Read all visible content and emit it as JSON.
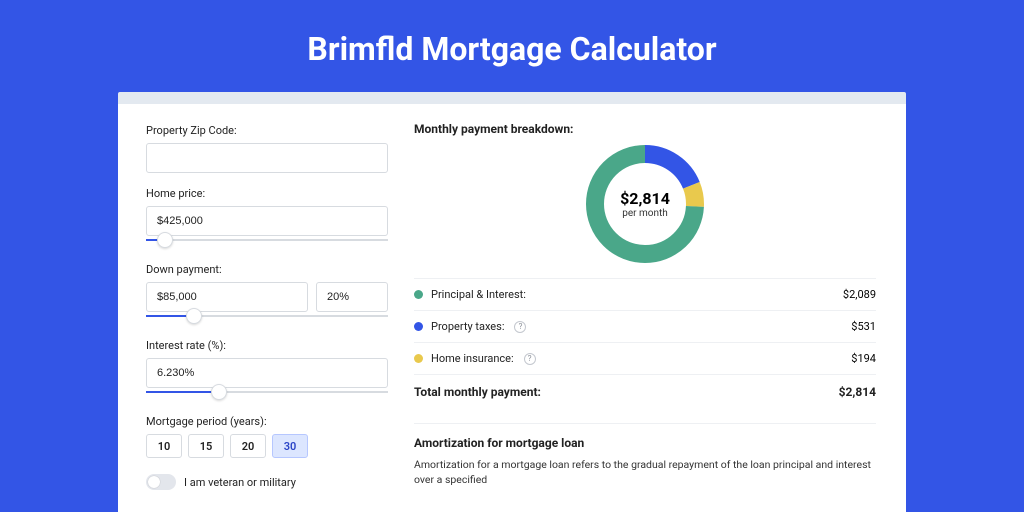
{
  "title": "Brimfld Mortgage Calculator",
  "form": {
    "zip_label": "Property Zip Code:",
    "zip_value": "",
    "home_price_label": "Home price:",
    "home_price_value": "$425,000",
    "home_price_slider_pct": 8,
    "down_payment_label": "Down payment:",
    "down_payment_value": "$85,000",
    "down_payment_pct_value": "20%",
    "down_payment_slider_pct": 20,
    "interest_label": "Interest rate (%):",
    "interest_value": "6.230%",
    "interest_slider_pct": 30,
    "period_label": "Mortgage period (years):",
    "period_options": [
      "10",
      "15",
      "20",
      "30"
    ],
    "period_selected": "30",
    "veteran_label": "I am veteran or military"
  },
  "breakdown": {
    "heading": "Monthly payment breakdown:",
    "center_amount": "$2,814",
    "center_sub": "per month",
    "items": [
      {
        "label": "Principal & Interest:",
        "value": "$2,089",
        "color": "#4aa789",
        "has_help": false
      },
      {
        "label": "Property taxes:",
        "value": "$531",
        "color": "#3355e6",
        "has_help": true
      },
      {
        "label": "Home insurance:",
        "value": "$194",
        "color": "#e9c94d",
        "has_help": true
      }
    ],
    "total_label": "Total monthly payment:",
    "total_value": "$2,814"
  },
  "chart_data": {
    "type": "pie",
    "title": "Monthly payment breakdown",
    "series": [
      {
        "name": "Principal & Interest",
        "value": 2089,
        "color": "#4aa789"
      },
      {
        "name": "Property taxes",
        "value": 531,
        "color": "#3355e6"
      },
      {
        "name": "Home insurance",
        "value": 194,
        "color": "#e9c94d"
      }
    ],
    "total": 2814,
    "center_label": "$2,814 per month"
  },
  "amort": {
    "title": "Amortization for mortgage loan",
    "text": "Amortization for a mortgage loan refers to the gradual repayment of the loan principal and interest over a specified"
  }
}
